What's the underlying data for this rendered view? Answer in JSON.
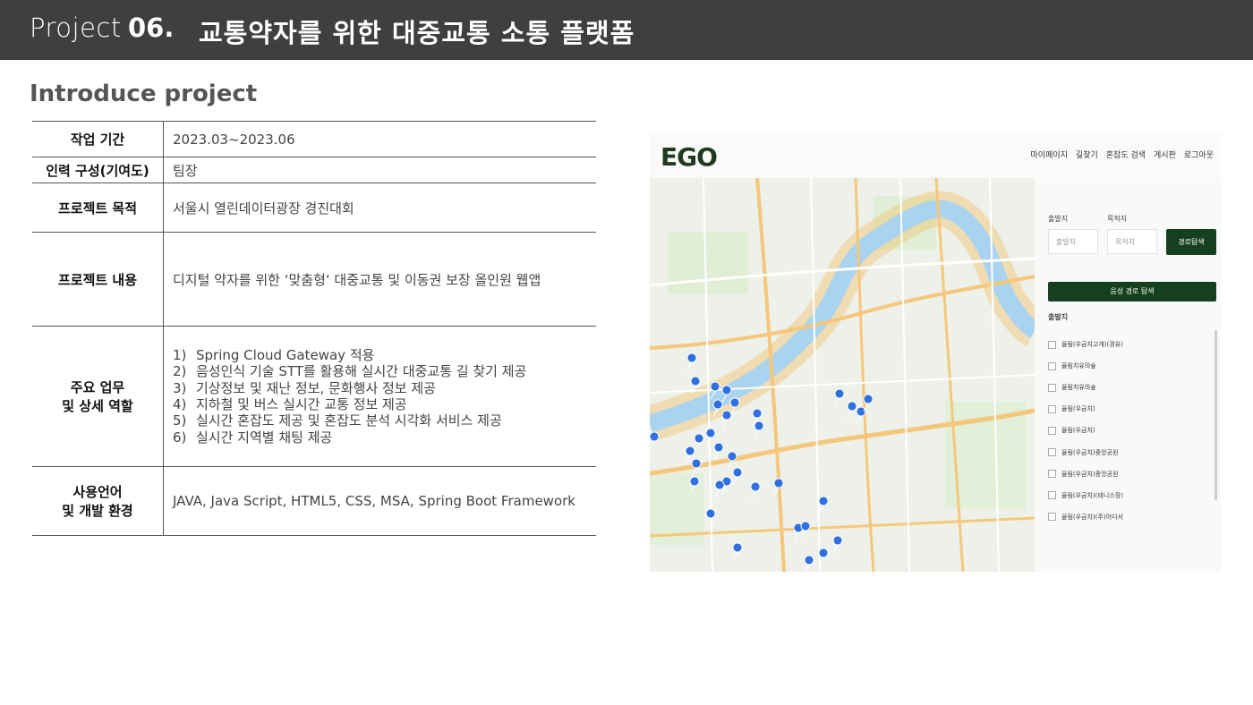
{
  "header": {
    "prefix": "Project",
    "number": "06.",
    "title": "교통약자를 위한 대중교통 소통 플랫폼"
  },
  "section_title": "Introduce project",
  "info": {
    "period": {
      "label": "작업 기간",
      "value": "2023.03~2023.06"
    },
    "team": {
      "label": "인력 구성(기여도)",
      "value": "팀장"
    },
    "purpose": {
      "label": "프로젝트 목적",
      "value": "서울시 열린데이터광장 경진대회"
    },
    "content": {
      "label": "프로젝트 내용",
      "value": "디지털 약자를 위한 ‘맞춤형‘ 대중교통 및 이동권 보장 올인원 웹앱"
    },
    "tasks": {
      "label_line1": "주요 업무",
      "label_line2": "및 상세 역할",
      "items": [
        {
          "num": "1)",
          "text": "Spring Cloud Gateway 적용"
        },
        {
          "num": "2)",
          "text": "음성인식 기술 STT를 활용해 실시간 대중교통 길 찾기 제공"
        },
        {
          "num": "3)",
          "text": "기상정보 및 재난 정보, 문화행사 정보 제공"
        },
        {
          "num": "4)",
          "text": "지하철 및 버스 실시간 교통 정보 제공"
        },
        {
          "num": "5)",
          "text": "실시간 혼잡도 제공 및 혼잡도 분석 시각화 서비스 제공"
        },
        {
          "num": "6)",
          "text": "실시간 지역별 채팅 제공"
        }
      ]
    },
    "stack": {
      "label_line1": "사용언어",
      "label_line2": "및 개발 환경",
      "value": "JAVA, Java Script, HTML5, CSS, MSA, Spring Boot Framework"
    }
  },
  "app": {
    "logo": "EGO",
    "nav": [
      "마이페이지",
      "길찾기",
      "혼잡도 검색",
      "게시판",
      "로그아웃"
    ],
    "origin_label": "출발지",
    "dest_label": "목적지",
    "origin_placeholder": "출발지",
    "dest_placeholder": "목적지",
    "search_button": "경로탐색",
    "voice_button": "음성 경로 탐색",
    "list_title": "출발지",
    "list_items": [
      "율림(우금치고개)(경유)",
      "율림치유의숲",
      "율림치유의숲",
      "율림(우금치)",
      "율림(우금치)",
      "율림(우금치)중앙공원",
      "율림(우금치)중앙공원",
      "율림(우금치)(테니스장)",
      "율림(우금치)(주)어디서"
    ],
    "colors": {
      "header_bg": "#3f3f3f",
      "app_green": "#15401f",
      "river": "#a9d3ee",
      "road": "#f5c77a",
      "marker": "#2f6fe0"
    }
  }
}
